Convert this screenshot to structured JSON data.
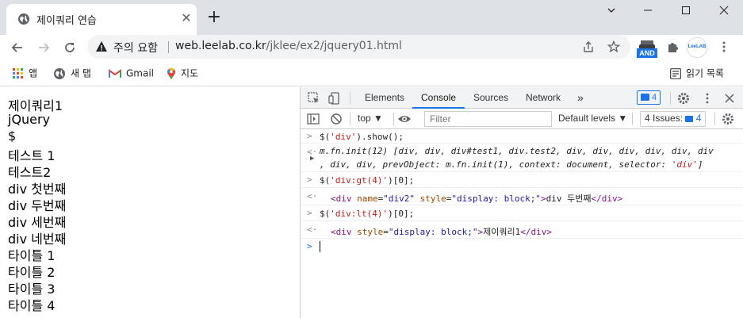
{
  "tab": {
    "title": "제이쿼리 연습",
    "close_glyph": "✕",
    "new_tab_glyph": "+"
  },
  "toolbar": {
    "security_label": "주의 요함",
    "url_host": "web.leelab.co.kr",
    "url_path": "/jklee/ex2/jquery01.html",
    "ext_and_label": "AND",
    "ext_leelab_label": "LeeLAB"
  },
  "bookmarks": {
    "apps": "앱",
    "news": "새 탭",
    "gmail": "Gmail",
    "maps": "지도",
    "reading_list": "읽기 목록"
  },
  "page": {
    "lines": [
      "제이쿼리1",
      "jQuery",
      "$",
      "테스트 1",
      "테스트2",
      "div 첫번째",
      "div 두번째",
      "div 세번째",
      "div 네번째",
      "타이틀 1",
      "타이틀 2",
      "타이틀 3",
      "타이틀 4"
    ]
  },
  "devtools": {
    "tabs": [
      "Elements",
      "Console",
      "Sources",
      "Network"
    ],
    "active_tab": "Console",
    "more_tabs": "»",
    "messages_badge": "4",
    "context": "top ▼",
    "filter_placeholder": "Filter",
    "levels": "Default levels ▼",
    "issues_label": "4 Issues:",
    "issues_count": "4",
    "console": {
      "cmd1_a": "$(",
      "cmd1_str": "'div'",
      "cmd1_b": ").show();",
      "out1_line1": "m.fn.init(12) [div, div, div#test1, div.test2, div, div, div, div, div, div",
      "out1_line2": ", div, div, prevObject: m.fn.init(1), context: document, selector: ",
      "out1_line2_str": "'div'",
      "out1_line2_end": "]",
      "cmd2_a": "$(",
      "cmd2_str": "'div:gt(4)'",
      "cmd2_b": ")[0];",
      "out2_tag_open": "<div ",
      "out2_attr1_name": "name",
      "out2_attr1_val": "\"div2\"",
      "out2_attr2_name": " style",
      "out2_attr2_val": "\"display: block;\"",
      "out2_close": ">",
      "out2_text": "div 두번째",
      "out2_end": "</div>",
      "cmd3_a": "$(",
      "cmd3_str": "'div:lt(4)'",
      "cmd3_b": ")[0];",
      "out3_tag_open": "<div ",
      "out3_attr_name": "style",
      "out3_attr_val": "\"display: block;\"",
      "out3_close": ">",
      "out3_text": "제이쿼리1",
      "out3_end": "</div>"
    }
  },
  "colors": {
    "accent": "#1a73e8",
    "tabstrip": "#dee1e6",
    "omnibox": "#f1f3f4"
  }
}
